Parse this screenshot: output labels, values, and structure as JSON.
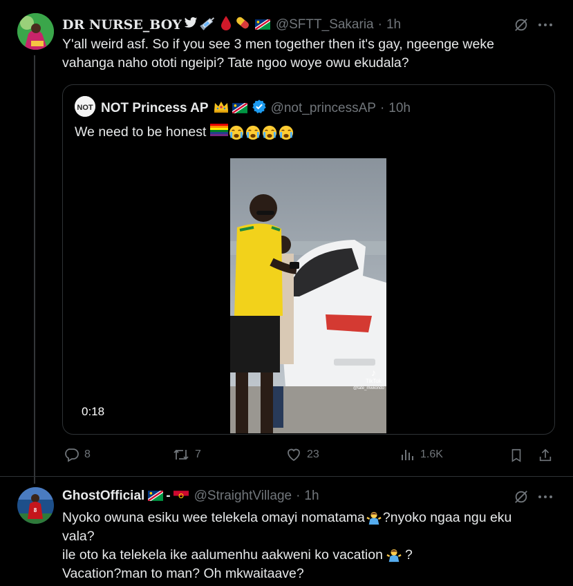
{
  "tweet": {
    "display_name": "DR NURSE_BOY",
    "handle": "@SFTT_Sakaria",
    "time": "1h",
    "text_line1": "Y'all weird asf. So if you see 3 men together then it's gay, ngeenge weke",
    "text_line2": "vahanga naho ototi ngeipi? Tate ngoo woye owu ekudala?",
    "quote": {
      "display_name": "NOT Princess AP",
      "handle": "@not_princessAP",
      "time": "10h",
      "text": "We need to be honest",
      "video_duration": "0:18",
      "video_watermark": "TikTok",
      "video_user": "@tate_mwiiondo"
    },
    "actions": {
      "replies": "8",
      "reposts": "7",
      "likes": "23",
      "views": "1.6K"
    }
  },
  "reply": {
    "display_name": "GhostOfficial",
    "separator": "-",
    "handle": "@StraightVillage",
    "time": "1h",
    "line1": "Nyoko owuna esiku wee telekela omayi nomatama",
    "line1b": "?nyoko ngaa ngu eku",
    "line2": "vala?",
    "line3": "ile oto ka telekela ike aalumenhu aakweni ko vacation",
    "line3b": "?",
    "line4": "Vacation?man to man? Oh mkwaitaave?"
  },
  "colors": {
    "background": "#000000",
    "text": "#e7e9ea",
    "muted": "#71767b",
    "border": "#2f3336",
    "verified": "#1d9bf0",
    "tiktok_shirt": "#f2d21b"
  },
  "icons": [
    "grok-icon",
    "more-icon",
    "reply-icon",
    "repost-icon",
    "like-icon",
    "views-icon",
    "bookmark-icon",
    "share-icon",
    "verified-icon",
    "twitter-bird-icon",
    "syringe-icon",
    "blood-drop-icon",
    "pill-icon",
    "namibia-flag-icon",
    "crown-icon",
    "rainbow-flag-icon",
    "crying-face-icon",
    "angola-flag-icon",
    "shrugging-man-icon"
  ]
}
